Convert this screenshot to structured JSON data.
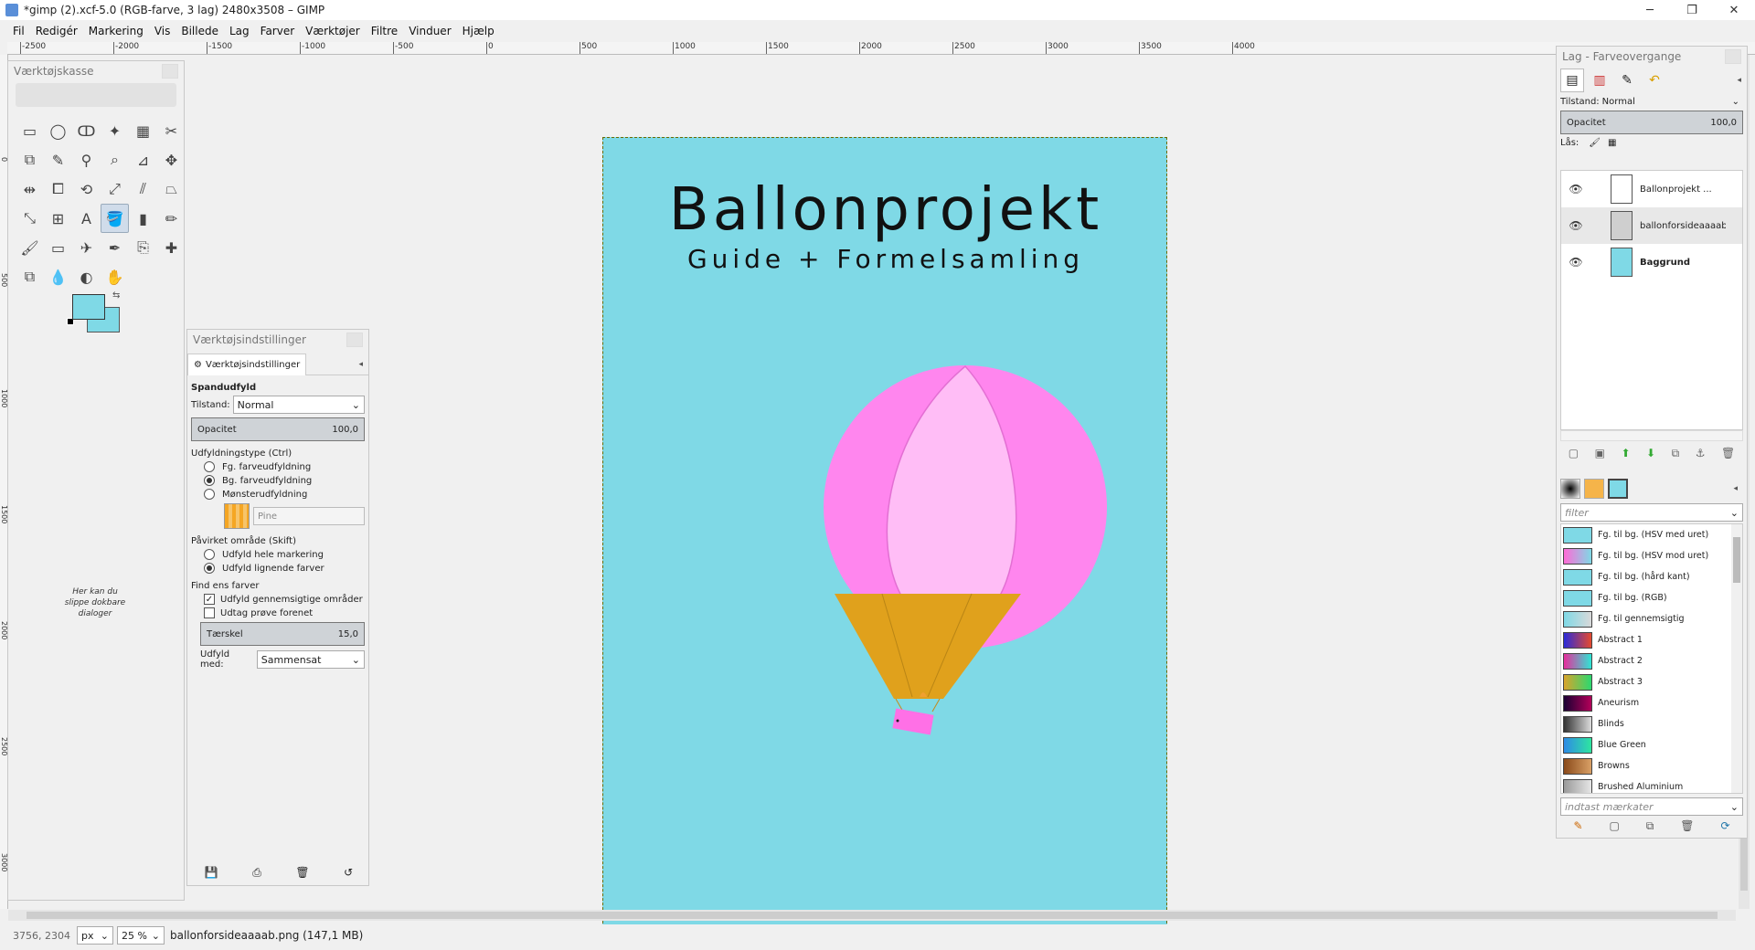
{
  "window": {
    "title": "*gimp (2).xcf-5.0 (RGB-farve, 3 lag) 2480x3508 – GIMP",
    "controls": [
      "─",
      "❐",
      "✕"
    ]
  },
  "menu": [
    "Fil",
    "Redigér",
    "Markering",
    "Vis",
    "Billede",
    "Lag",
    "Farver",
    "Værktøjer",
    "Filtre",
    "Vinduer",
    "Hjælp"
  ],
  "ruler": {
    "h_labels": [
      "-2500",
      "-2000",
      "-1500",
      "-1000",
      "-500",
      "0",
      "500",
      "1000",
      "1500",
      "2000",
      "2500",
      "3000",
      "3500",
      "4000"
    ],
    "v_labels": [
      "0",
      "500",
      "1000",
      "1500",
      "2000",
      "2500",
      "3000"
    ]
  },
  "canvas": {
    "title": "Ballonprojekt",
    "subtitle": "Guide + Formelsamling",
    "background_color": "#7fd9e6"
  },
  "toolbox": {
    "title": "Værktøjskasse",
    "dock_hint": "Her kan du slippe dokbare dialoger",
    "tools": [
      "rect-select-icon",
      "ellipse-select-icon",
      "lasso-icon",
      "fuzzy-select-icon",
      "color-select-icon",
      "scissors-icon",
      "foreground-select-icon",
      "paths-icon",
      "color-picker-icon",
      "zoom-icon",
      "measure-icon",
      "move-icon",
      "align-icon",
      "crop-icon",
      "rotate-icon",
      "scale-icon",
      "shear-icon",
      "perspective-icon",
      "transform-icon",
      "cage-icon",
      "text-icon",
      "bucket-fill-icon",
      "blend-icon",
      "pencil-icon",
      "paintbrush-icon",
      "eraser-icon",
      "airbrush-icon",
      "ink-icon",
      "clone-icon",
      "heal-icon",
      "perspective-clone-icon",
      "blur-icon",
      "dodge-icon",
      "smudge-icon"
    ],
    "tool_glyphs": [
      "▭",
      "◯",
      "ↀ",
      "✦",
      "▦",
      "✂",
      "⧉",
      "✎",
      "⚲",
      "⌕",
      "⊿",
      "✥",
      "⇹",
      "⧠",
      "⟲",
      "⤢",
      "⫽",
      "⏢",
      "⤡",
      "⊞",
      "A",
      "🪣",
      "▮",
      "✏",
      "🖌",
      "▭",
      "✈",
      "✒",
      "⎘",
      "✚",
      "⧉",
      "💧",
      "◐",
      "✋"
    ],
    "fg_color": "#7fd9e6",
    "bg_color": "#7fd9e6"
  },
  "tool_options": {
    "panel_title": "Værktøjsindstillinger",
    "tab_label": "Værktøjsindstillinger",
    "tool_name": "Spandudfyld",
    "mode_label": "Tilstand:",
    "mode_value": "Normal",
    "opacity_label": "Opacitet",
    "opacity_value": "100,0",
    "fill_type_label": "Udfyldningstype  (Ctrl)",
    "fill_types": [
      "Fg. farveudfyldning",
      "Bg. farveudfyldning",
      "Mønsterudfyldning"
    ],
    "fill_type_selected": 1,
    "pattern_name": "Pine",
    "affected_label": "Påvirket område  (Skift)",
    "affected": [
      "Udfyld hele markering",
      "Udfyld lignende farver"
    ],
    "affected_selected": 1,
    "find_label": "Find ens farver",
    "checks": [
      {
        "label": "Udfyld gennemsigtige områder",
        "checked": true
      },
      {
        "label": "Udtag prøve forenet",
        "checked": false
      }
    ],
    "threshold_label": "Tærskel",
    "threshold_value": "15,0",
    "fill_with_label": "Udfyld med:",
    "fill_with_value": "Sammensat",
    "footer_icons": [
      "save-options-icon",
      "restore-options-icon",
      "delete-options-icon",
      "reset-options-icon"
    ]
  },
  "layers": {
    "panel_title": "Lag - Farveovergange",
    "mode_label": "Tilstand:",
    "mode_value": "Normal",
    "opacity_label": "Opacitet",
    "opacity_value": "100,0",
    "lock_label": "Lås:",
    "items": [
      {
        "name": "Ballonprojekt ...",
        "thumb_color": "#ffffff",
        "bold": false
      },
      {
        "name": "ballonforsideaaaab.pn",
        "thumb_color": "#cfcfcf",
        "bold": false
      },
      {
        "name": "Baggrund",
        "thumb_color": "#7fd9e6",
        "bold": true
      }
    ]
  },
  "gradients": {
    "filter_placeholder": "filter",
    "tags_placeholder": "indtast mærkater",
    "items": [
      {
        "name": "Fg. til bg. (HSV med uret)",
        "c1": "#7fd9e6",
        "c2": "#7fd9e6"
      },
      {
        "name": "Fg. til bg. (HSV mod uret)",
        "c1": "#ff6bd6",
        "c2": "#7fd9e6"
      },
      {
        "name": "Fg. til bg. (hård kant)",
        "c1": "#7fd9e6",
        "c2": "#7fd9e6"
      },
      {
        "name": "Fg. til bg. (RGB)",
        "c1": "#7fd9e6",
        "c2": "#7fd9e6"
      },
      {
        "name": "Fg. til gennemsigtig",
        "c1": "#7fd9e6",
        "c2": "#d9d9d9"
      },
      {
        "name": "Abstract 1",
        "c1": "#2b2bd9",
        "c2": "#e64a2e"
      },
      {
        "name": "Abstract 2",
        "c1": "#e62e9c",
        "c2": "#2ee6d4"
      },
      {
        "name": "Abstract 3",
        "c1": "#d9a32b",
        "c2": "#2bd970"
      },
      {
        "name": "Aneurism",
        "c1": "#1a0033",
        "c2": "#b30059"
      },
      {
        "name": "Blinds",
        "c1": "#333333",
        "c2": "#dddddd"
      },
      {
        "name": "Blue Green",
        "c1": "#2e8ae6",
        "c2": "#2ee6a0"
      },
      {
        "name": "Browns",
        "c1": "#8a4a1a",
        "c2": "#d9a066"
      },
      {
        "name": "Brushed Aluminium",
        "c1": "#9a9a9a",
        "c2": "#e6e6e6"
      }
    ]
  },
  "status": {
    "coords": "3756, 2304",
    "unit": "px",
    "zoom": "25 %",
    "message": "ballonforsideaaaab.png (147,1 MB)"
  }
}
